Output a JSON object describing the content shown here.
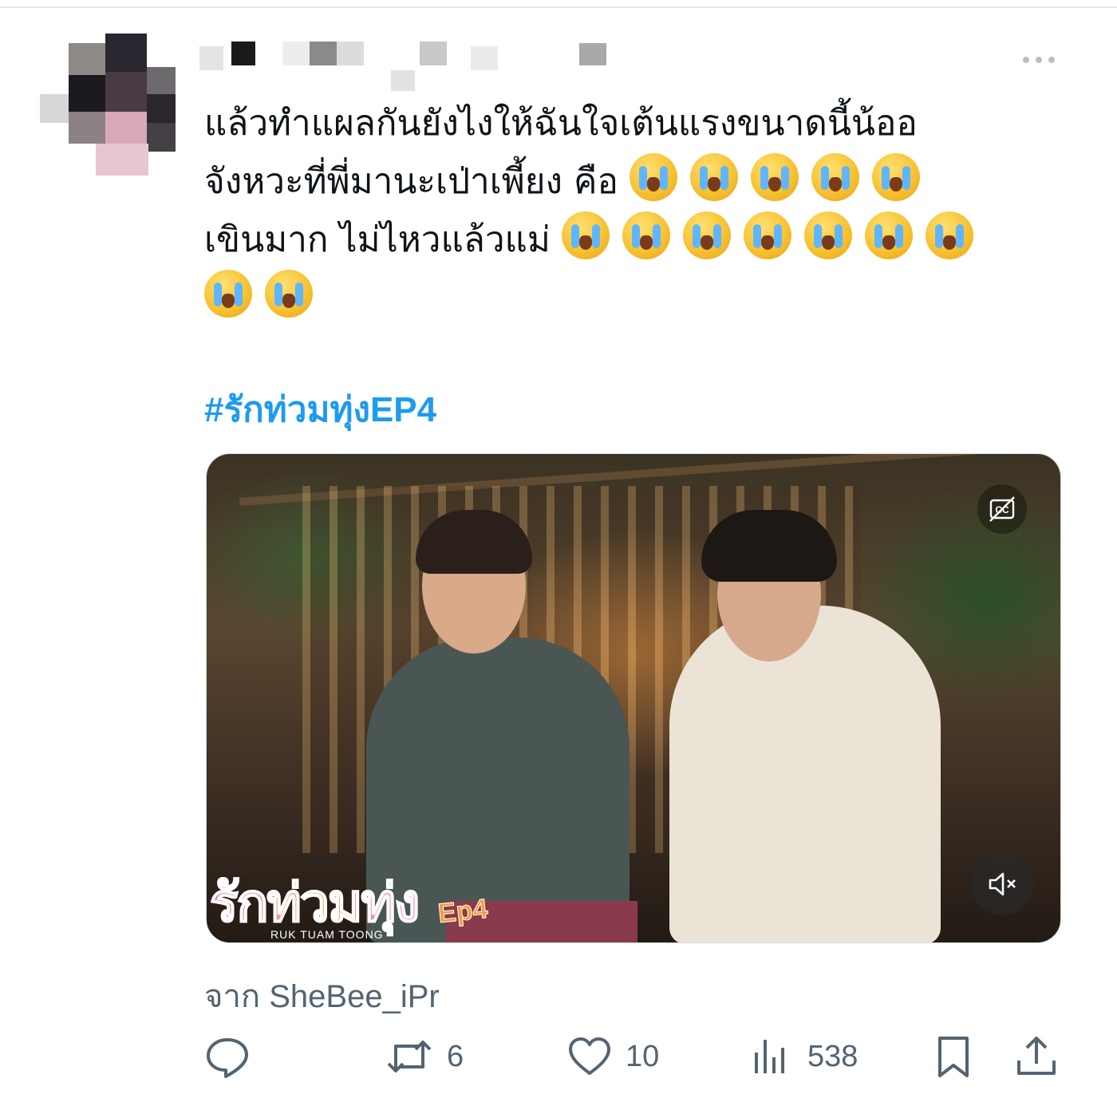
{
  "tweet": {
    "text_lines": [
      "แล้วทำแผลกันยังไงให้ฉันใจเต้นแรงขนาดนี้น้ออ",
      "จังหวะที่พี่มานะเป่าเพี้ยง คือ",
      "เขินมาก ไม่ไหวแล้วแม่"
    ],
    "emoji_name": "loudly-crying-face",
    "emoji_counts": [
      5,
      7,
      2
    ],
    "hashtag": "#รักท่วมทุ่งEP4",
    "source_prefix": "จาก",
    "source_handle": "SheBee_iPr"
  },
  "media": {
    "logo_title": "รักท่วมทุ่ง",
    "logo_ep": "Ep4",
    "logo_subtitle": "RUK TUAM TOONG",
    "cc_icon": "captions-icon",
    "mute_icon": "volume-muted-icon"
  },
  "actions": {
    "reply": {
      "icon": "reply-icon",
      "count": ""
    },
    "retweet": {
      "icon": "retweet-icon",
      "count": "6"
    },
    "like": {
      "icon": "heart-icon",
      "count": "10"
    },
    "views": {
      "icon": "views-icon",
      "count": "538"
    },
    "bookmark": {
      "icon": "bookmark-icon"
    },
    "share": {
      "icon": "share-icon"
    }
  },
  "colors": {
    "link": "#1d9bf0",
    "text": "#0f1419",
    "secondary": "#536471"
  }
}
